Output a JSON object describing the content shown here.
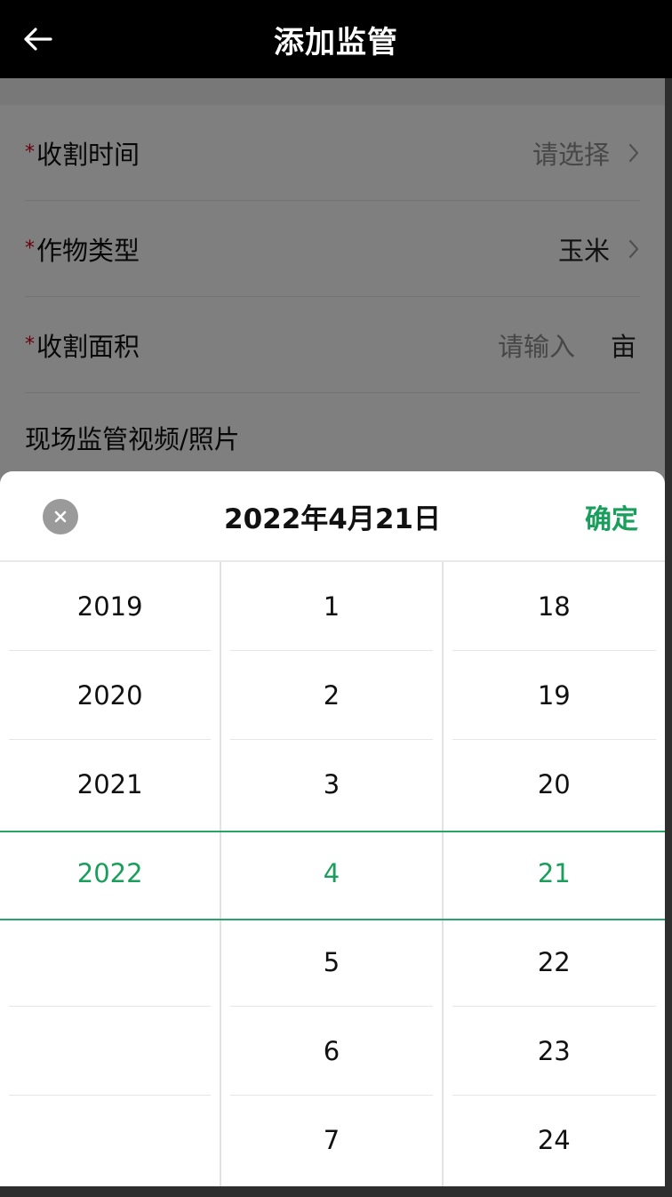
{
  "header": {
    "title": "添加监管",
    "back_icon": "arrow-left-icon"
  },
  "form": {
    "rows": [
      {
        "label": "收割时间",
        "required": "*",
        "value": "请选择",
        "is_placeholder": true,
        "has_chevron": true
      },
      {
        "label": "作物类型",
        "required": "*",
        "value": "玉米",
        "is_placeholder": false,
        "has_chevron": true
      },
      {
        "label": "收割面积",
        "required": "*",
        "value": "请输入",
        "is_placeholder": true,
        "unit": "亩"
      },
      {
        "label": "现场监管视频/照片"
      }
    ]
  },
  "picker": {
    "title": "2022年4月21日",
    "confirm_label": "确定",
    "close_icon": "close-icon",
    "years": [
      "2019",
      "2020",
      "2021",
      "2022",
      "",
      "",
      ""
    ],
    "months": [
      "1",
      "2",
      "3",
      "4",
      "5",
      "6",
      "7"
    ],
    "days": [
      "18",
      "19",
      "20",
      "21",
      "22",
      "23",
      "24"
    ],
    "selected_index": 3
  },
  "colors": {
    "accent": "#1a9e5c",
    "required": "#d0021b",
    "header_bg": "#000000"
  }
}
